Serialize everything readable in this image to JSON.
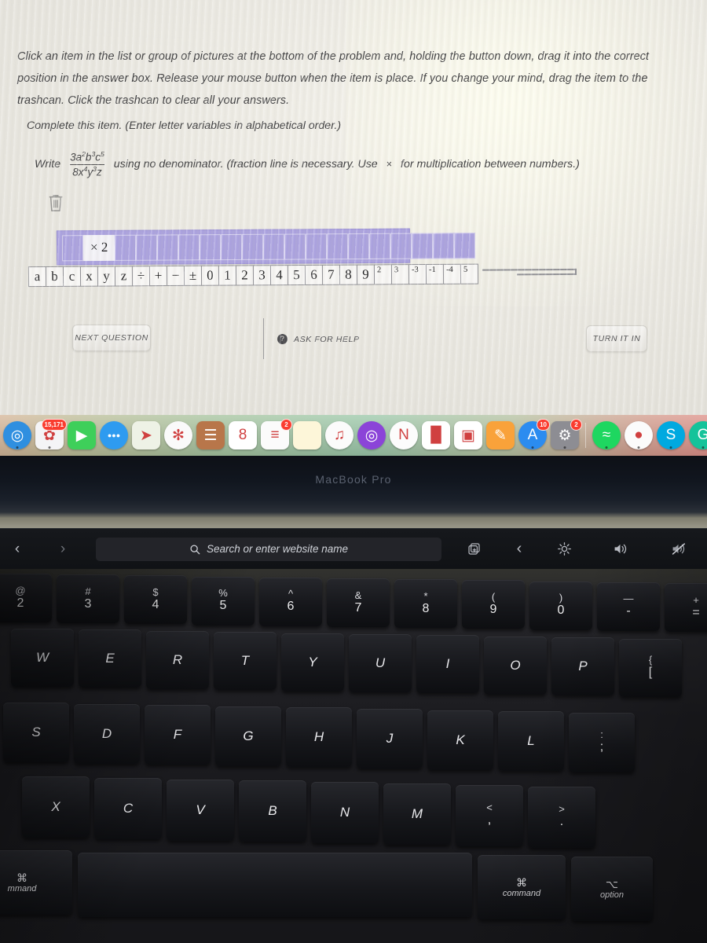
{
  "problem": {
    "instructions": "Click an item in the list or group of pictures at the bottom of the problem and, holding the button down, drag it into the correct position in the answer box. Release your mouse button when the item is place. If you change your mind, drag the item to the trashcan. Click the trashcan to clear all your answers.",
    "complete_line": "Complete this item. (Enter letter variables in alphabetical order.)",
    "write_label": "Write",
    "fraction": {
      "numerator": "3a2b3c5",
      "numerator_parts": [
        {
          "base": "3",
          "exp": ""
        },
        {
          "base": "a",
          "exp": "2"
        },
        {
          "base": "b",
          "exp": "3"
        },
        {
          "base": "c",
          "exp": "5"
        }
      ],
      "denominator_parts": [
        {
          "base": "8",
          "exp": ""
        },
        {
          "base": "x",
          "exp": "4"
        },
        {
          "base": "y",
          "exp": "3"
        },
        {
          "base": "z",
          "exp": ""
        }
      ]
    },
    "tail_text_1": "using no denominator. (fraction line is necessary. Use",
    "tail_mul_symbol": "×",
    "tail_text_2": "for multiplication between numbers.)",
    "trash_tooltip": "trashcan",
    "answer_box": {
      "filled": [
        "",
        "× 2"
      ],
      "empty_slot_count": 17
    },
    "palette_tiles": [
      "a",
      "b",
      "c",
      "x",
      "y",
      "z",
      "÷",
      "+",
      "−",
      "±",
      "0",
      "1",
      "2",
      "3",
      "4",
      "5",
      "6",
      "7",
      "8",
      "9"
    ],
    "palette_exponent_tiles": [
      "2",
      "3",
      "-3",
      "-1",
      "-4",
      "5"
    ],
    "buttons": {
      "next_question": "NEXT QUESTION",
      "ask_for_help": "ASK FOR HELP",
      "ask_icon_glyph": "?",
      "turn_it_in": "TURN IT IN"
    },
    "colors": {
      "answer_box_fill": "#a9a0de",
      "tile_fill": "#f7f6f4",
      "screen_bg": "#eceae3"
    }
  },
  "dock": {
    "items": [
      {
        "name": "safari",
        "glyph": "◎",
        "bg": "#2f8fe0",
        "round": true,
        "badge": "",
        "running": true
      },
      {
        "name": "photos",
        "glyph": "✿",
        "bg": "#f4f4f6",
        "round": false,
        "badge": "15,171",
        "running": true
      },
      {
        "name": "facetime",
        "glyph": "▶",
        "bg": "#3ecf5a",
        "round": false,
        "badge": "",
        "running": false
      },
      {
        "name": "messages",
        "glyph": "●●●",
        "bg": "#2e9bf0",
        "round": true,
        "badge": "",
        "running": false
      },
      {
        "name": "maps",
        "glyph": "➤",
        "bg": "#eef2e6",
        "round": false,
        "badge": "",
        "running": false
      },
      {
        "name": "photos-flower",
        "glyph": "✻",
        "bg": "#fafafa",
        "round": true,
        "badge": "",
        "running": false
      },
      {
        "name": "contacts",
        "glyph": "☰",
        "bg": "#b8764a",
        "round": false,
        "badge": "",
        "running": false
      },
      {
        "name": "calendar",
        "glyph": "8",
        "bg": "#ffffff",
        "round": false,
        "badge": "",
        "running": false
      },
      {
        "name": "reminders",
        "glyph": "≡",
        "bg": "#fbfbfb",
        "round": false,
        "badge": "2",
        "running": false
      },
      {
        "name": "notes",
        "glyph": "",
        "bg": "#fdf6d9",
        "round": false,
        "badge": "",
        "running": false
      },
      {
        "name": "music",
        "glyph": "♫",
        "bg": "#fbfbfb",
        "round": true,
        "badge": "",
        "running": false
      },
      {
        "name": "podcasts",
        "glyph": "◎",
        "bg": "#8b44d8",
        "round": true,
        "badge": "",
        "running": false
      },
      {
        "name": "news",
        "glyph": "N",
        "bg": "#fcfcfc",
        "round": true,
        "badge": "",
        "running": false
      },
      {
        "name": "numbers",
        "glyph": "█",
        "bg": "#ffffff",
        "round": false,
        "badge": "",
        "running": false
      },
      {
        "name": "keynote",
        "glyph": "▣",
        "bg": "#ffffff",
        "round": false,
        "badge": "",
        "running": false
      },
      {
        "name": "pages",
        "glyph": "✎",
        "bg": "#f9a23a",
        "round": false,
        "badge": "",
        "running": false
      },
      {
        "name": "app-store",
        "glyph": "A",
        "bg": "#2b8cf0",
        "round": true,
        "badge": "10",
        "running": true
      },
      {
        "name": "system-preferences",
        "glyph": "⚙",
        "bg": "#8d8d93",
        "round": false,
        "badge": "2",
        "running": true
      },
      {
        "name": "spotify",
        "glyph": "≈",
        "bg": "#1ed760",
        "round": true,
        "badge": "",
        "running": true
      },
      {
        "name": "record-app",
        "glyph": "●",
        "bg": "#fbfbfb",
        "round": true,
        "badge": "",
        "running": true
      },
      {
        "name": "skype",
        "glyph": "S",
        "bg": "#00a9e0",
        "round": true,
        "badge": "",
        "running": true
      },
      {
        "name": "grammarly",
        "glyph": "G",
        "bg": "#15c39a",
        "round": true,
        "badge": "",
        "running": true
      }
    ]
  },
  "laptop": {
    "model_label": "MacBook Pro"
  },
  "touchbar": {
    "back_glyph": "‹",
    "forward_glyph": "›",
    "search_placeholder": "Search or enter website name",
    "search_icon": "search-icon",
    "right_buttons": [
      {
        "name": "new-tab-icon",
        "glyph": "➕"
      },
      {
        "name": "expand-left-icon",
        "glyph": "‹"
      },
      {
        "name": "brightness-icon",
        "glyph": "☀"
      },
      {
        "name": "volume-icon",
        "glyph": "🔊"
      },
      {
        "name": "mute-icon",
        "glyph": "🔇"
      }
    ]
  },
  "keyboard": {
    "number_row": [
      {
        "top": "@",
        "bot": "2"
      },
      {
        "top": "#",
        "bot": "3"
      },
      {
        "top": "$",
        "bot": "4"
      },
      {
        "top": "%",
        "bot": "5"
      },
      {
        "top": "^",
        "bot": "6"
      },
      {
        "top": "&",
        "bot": "7"
      },
      {
        "top": "*",
        "bot": "8"
      },
      {
        "top": "(",
        "bot": "9"
      },
      {
        "top": ")",
        "bot": "0"
      },
      {
        "top": "—",
        "bot": "-"
      },
      {
        "top": "+",
        "bot": "="
      }
    ],
    "top_letter_row": [
      "W",
      "E",
      "R",
      "T",
      "Y",
      "U",
      "I",
      "O",
      "P"
    ],
    "top_letter_row_last": {
      "top": "{",
      "bot": "["
    },
    "home_row": [
      "S",
      "D",
      "F",
      "G",
      "H",
      "J",
      "K",
      "L"
    ],
    "home_row_last": {
      "top": ":",
      "bot": ";"
    },
    "bottom_row": [
      "X",
      "C",
      "V",
      "B",
      "N",
      "M"
    ],
    "bottom_row_punct": [
      {
        "top": "<",
        "bot": ","
      },
      {
        "top": ">",
        "bot": "."
      }
    ],
    "modifiers": {
      "command_glyph": "⌘",
      "command_label": "command",
      "option_glyph": "⌥",
      "option_label": "option",
      "left_command_label": "mmand",
      "space_label": ""
    }
  }
}
